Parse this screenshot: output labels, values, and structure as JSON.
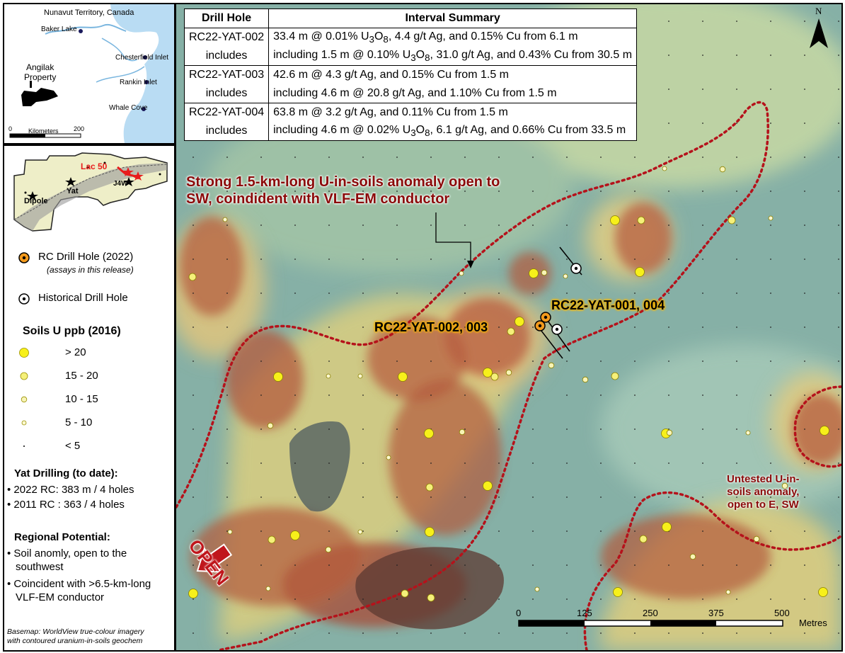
{
  "inset_map": {
    "title": "Nunavut Territory, Canada",
    "places": [
      "Baker Lake",
      "Chesterfield Inlet",
      "Rankin Inlet",
      "Whale Cove"
    ],
    "property_label": "Angilak\nProperty",
    "scale_zero": "0",
    "scale_unit": "Kilometers",
    "scale_max": "200"
  },
  "property_map": {
    "labels": [
      "Lac 50",
      "J4W",
      "Yat",
      "Dipole"
    ]
  },
  "legend": {
    "rc_drill": "RC Drill Hole (2022)",
    "rc_drill_note": "(assays in this release)",
    "historical_drill": "Historical Drill Hole",
    "soils_title": "Soils U ppb (2016)",
    "soils_classes": [
      "> 20",
      "15 - 20",
      "10 - 15",
      "5 - 10",
      "< 5"
    ],
    "drilling_title": "Yat Drilling (to date):",
    "drilling_items": [
      "2022 RC: 383 m / 4 holes",
      "2011 RC : 363 / 4 holes"
    ],
    "potential_title": "Regional Potential:",
    "potential_items": [
      "Soil anomly, open to the southwest",
      "Coincident with >6.5-km-long VLF-EM conductor"
    ],
    "basemap_note_1": "Basemap: WorldView true-colour imagery",
    "basemap_note_2": "with contoured uranium-in-soils geochem"
  },
  "table": {
    "headers": [
      "Drill Hole",
      "Interval Summary"
    ],
    "rows": [
      {
        "hole": "RC22-YAT-002",
        "sub": "includes",
        "main_pre": "33.4 m @ 0.01% U",
        "main_post": ", 4.4 g/t Ag, and 0.15% Cu from 6.1 m",
        "inc_pre": "including 1.5 m @ 0.10% U",
        "inc_post": ", 31.0 g/t Ag, and 0.43% Cu from 30.5 m"
      },
      {
        "hole": "RC22-YAT-003",
        "sub": "includes",
        "main_pre": "42.6 m @ 4.3 g/t Ag, and 0.15% Cu from 1.5 m",
        "main_post": "",
        "inc_pre": "including 4.6 m @ 20.8 g/t Ag, and 1.10% Cu from 1.5 m",
        "inc_post": ""
      },
      {
        "hole": "RC22-YAT-004",
        "sub": "includes",
        "main_pre": "63.8 m @ 3.2 g/t Ag, and 0.11% Cu from 1.5 m",
        "main_post": "",
        "inc_pre": "including 4.6 m @ 0.02% U",
        "inc_post": ", 6.1 g/t Ag, and 0.66% Cu from 33.5 m"
      }
    ],
    "u3o8": {
      "u": "3",
      "o": "O",
      "n": "8"
    }
  },
  "annotations": {
    "anomaly_1": "Strong 1.5-km-long U-in-soils anomaly open to",
    "anomaly_2": "SW, coindident with VLF-EM conductor",
    "hole_a": "RC22-YAT-001, 004",
    "hole_b": "RC22-YAT-002, 003",
    "untested": "Untested U-in-\nsoils anomaly,\nopen to E, SW",
    "open": "OPEN"
  },
  "north": "N",
  "scale_bar": {
    "ticks": [
      "0",
      "125",
      "250",
      "375",
      "500"
    ],
    "unit": "Metres"
  },
  "colors": {
    "anomaly_line": "#b5121b",
    "soil_dot": "#f7f01a",
    "rc_orange": "#f39a1c"
  }
}
